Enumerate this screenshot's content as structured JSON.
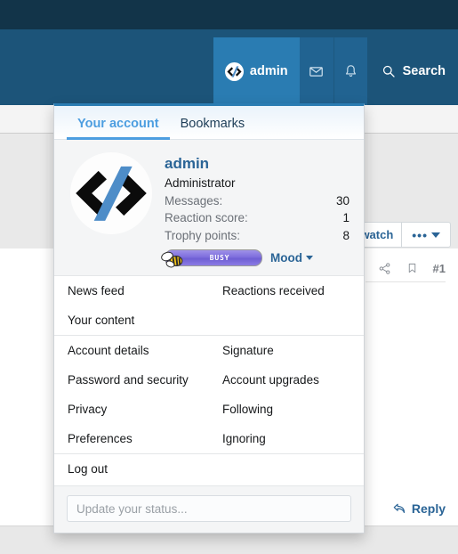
{
  "navbar": {
    "account_tab": {
      "label": "admin",
      "avatar_icon": "code-logo-avatar-icon"
    },
    "inbox_icon": "envelope-icon",
    "alerts_icon": "bell-icon",
    "search": {
      "label": "Search",
      "icon": "search-icon"
    }
  },
  "thread": {
    "watch_button": {
      "label": "watch"
    },
    "more_button": {
      "dots": "•••"
    },
    "post_meta": {
      "share_icon": "share-icon",
      "bookmark_icon": "bookmark-icon",
      "post_number": "#1"
    },
    "reply_button": {
      "label": "Reply",
      "icon": "reply-arrow-icon"
    }
  },
  "account_menu": {
    "tabs": [
      {
        "label": "Your account",
        "active": true
      },
      {
        "label": "Bookmarks",
        "active": false
      }
    ],
    "user": {
      "avatar_icon": "code-logo-avatar-icon",
      "username": "admin",
      "title": "Administrator",
      "stats": [
        {
          "label": "Messages:",
          "value": "30"
        },
        {
          "label": "Reaction score:",
          "value": "1"
        },
        {
          "label": "Trophy points:",
          "value": "8"
        }
      ],
      "mood": {
        "badge_text": "Busy",
        "badge_icon": "bee-icon",
        "link_label": "Mood"
      }
    },
    "link_groups": [
      [
        {
          "left": "News feed",
          "right": "Reactions received"
        },
        {
          "left": "Your content",
          "right": ""
        }
      ],
      [
        {
          "left": "Account details",
          "right": "Signature"
        },
        {
          "left": "Password and security",
          "right": "Account upgrades"
        },
        {
          "left": "Privacy",
          "right": "Following"
        },
        {
          "left": "Preferences",
          "right": "Ignoring"
        }
      ],
      [
        {
          "left": "Log out",
          "right": ""
        }
      ]
    ],
    "status": {
      "placeholder": "Update your status...",
      "value": ""
    }
  },
  "colors": {
    "navbar_top": "#123449",
    "navbar_main": "#1c5479",
    "accent_tab": "#2a7cb2",
    "active_tab_underline": "#4d9ee0",
    "link_blue": "#2a6496",
    "mood_badge": "#7e6edd"
  }
}
